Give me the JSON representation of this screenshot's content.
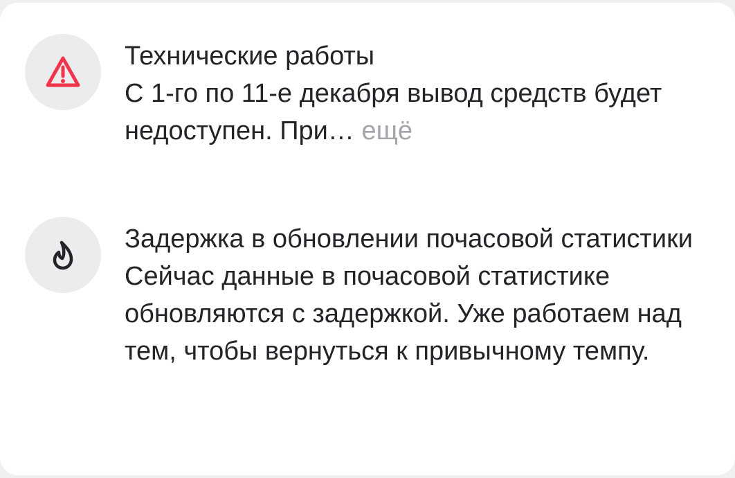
{
  "notices": [
    {
      "icon": "warning-triangle-icon",
      "icon_color": "#f0344c",
      "title": "Технические работы",
      "body": "С 1-го по 11-е декабря вывод средств будет недоступен. При…",
      "more_label": "ещё"
    },
    {
      "icon": "flame-icon",
      "icon_color": "#222428",
      "title": "Задержка в обновлении почасовой статистики",
      "body": "Сейчас данные в почасовой статистике обновляются с задержкой. Уже работаем над тем, чтобы вернуться к привычному темпу."
    }
  ]
}
